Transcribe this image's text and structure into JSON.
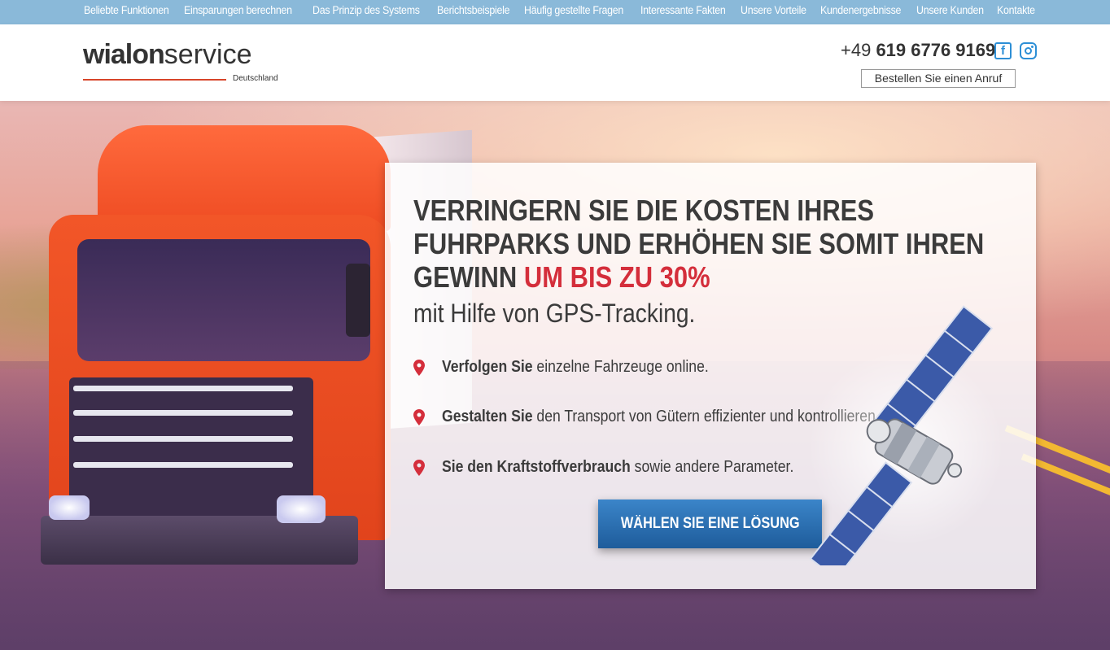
{
  "nav": {
    "items": [
      {
        "label": "Beliebte Funktionen"
      },
      {
        "label": "Einsparungen berechnen"
      },
      {
        "label": "Das Prinzip des Systems"
      },
      {
        "label": "Berichtsbeispiele"
      },
      {
        "label": "Häufig gestellte Fragen"
      },
      {
        "label": "Interessante Fakten"
      },
      {
        "label": "Unsere Vorteile"
      },
      {
        "label": "Kundenergebnisse"
      },
      {
        "label": "Unsere Kunden"
      },
      {
        "label": "Kontakte"
      }
    ]
  },
  "header": {
    "logo_text_bold": "wialon",
    "logo_text": "service",
    "logo_sub": "Deutschland",
    "phone_prefix": "+49 ",
    "phone_number": "619 6776 9169",
    "social": [
      "facebook-icon",
      "instagram-icon"
    ],
    "call_button": "Bestellen Sie einen Anruf"
  },
  "hero": {
    "headline_part1": "VERRINGERN SIE DIE KOSTEN IHRES FUHRPARKS UND ERHÖHEN SIE SOMIT IHREN GEWINN ",
    "headline_accent": "UM BIS ZU 30%",
    "subheadline": "mit Hilfe von GPS-Tracking.",
    "features": [
      {
        "bold": "Verfolgen Sie",
        "rest": " einzelne Fahrzeuge online."
      },
      {
        "bold": "Gestalten Sie",
        "rest": " den Transport von Gütern effizienter und kontrollieren"
      },
      {
        "bold": "Sie den Kraftstoffverbrauch",
        "rest": " sowie andere Parameter."
      }
    ],
    "cta": "WÄHLEN SIE EINE LÖSUNG"
  },
  "colors": {
    "nav_bg": "#8ab9d9",
    "accent_red": "#d42e3b",
    "cta_blue": "#2a6fb3",
    "icon_blue": "#2d8fd6"
  }
}
